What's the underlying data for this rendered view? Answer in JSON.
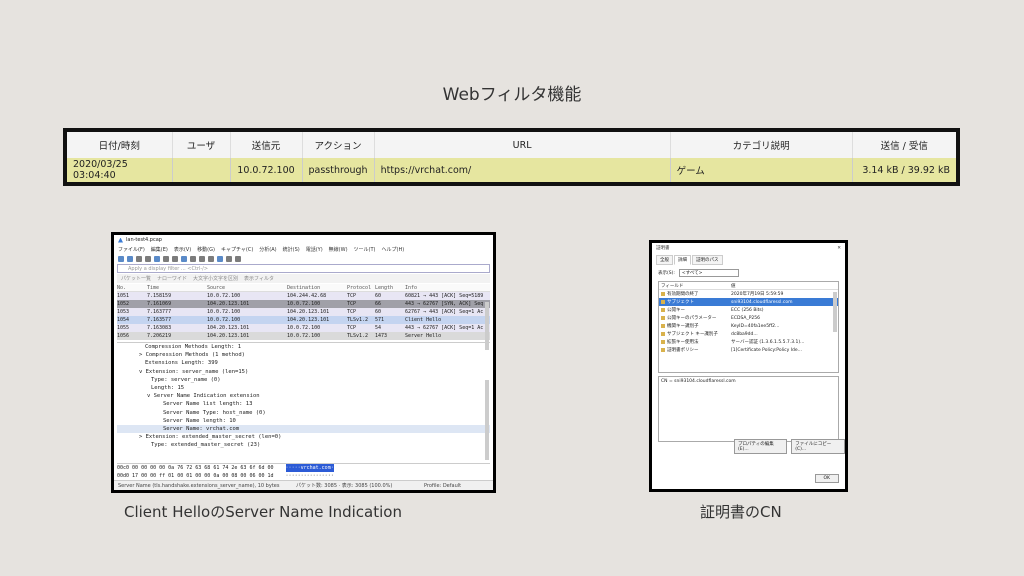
{
  "title": "Webフィルタ機能",
  "log_table": {
    "headers": [
      "日付/時刻",
      "ユーザ",
      "送信元",
      "アクション",
      "URL",
      "カテゴリ説明",
      "送信 / 受信"
    ],
    "row": [
      "2020/03/25 03:04:40",
      "",
      "10.0.72.100",
      "passthrough",
      "https://vrchat.com/",
      "ゲーム",
      "3.14 kB / 39.92 kB"
    ]
  },
  "wireshark": {
    "window_title": "lan-test4.pcap",
    "menu": [
      "ファイル(F)",
      "編集(E)",
      "表示(V)",
      "移動(G)",
      "キャプチャ(C)",
      "分析(A)",
      "統計(S)",
      "電話(Y)",
      "無線(W)",
      "ツール(T)",
      "ヘルプ(H)"
    ],
    "filter_placeholder": "Apply a display filter ... <Ctrl-/>",
    "filter2": [
      "パケット一覧",
      "ナローワイド",
      "大文字小文字を区別",
      "表示フィルタ"
    ],
    "columns": [
      "No.",
      "Time",
      "Source",
      "Destination",
      "Protocol",
      "Length",
      "Info"
    ],
    "packets": [
      [
        "1051",
        "7.158159",
        "10.0.72.100",
        "104.244.42.68",
        "TCP",
        "60",
        "60821 → 443 [ACK] Seq=5189"
      ],
      [
        "1052",
        "7.161069",
        "104.20.123.101",
        "10.0.72.100",
        "TCP",
        "66",
        "443 → 62767 [SYN, ACK] Seq"
      ],
      [
        "1053",
        "7.163777",
        "10.0.72.100",
        "104.20.123.101",
        "TCP",
        "60",
        "62767 → 443 [ACK] Seq=1 Ac"
      ],
      [
        "1054",
        "7.163577",
        "10.0.72.100",
        "104.20.123.101",
        "TLSv1.2",
        "571",
        "Client Hello"
      ],
      [
        "1055",
        "7.163083",
        "104.20.123.101",
        "10.0.72.100",
        "TCP",
        "54",
        "443 → 62767 [ACK] Seq=1 Ac"
      ],
      [
        "1056",
        "7.206219",
        "104.20.123.101",
        "10.0.72.100",
        "TLSv1.2",
        "1473",
        "Server Hello"
      ]
    ],
    "detail_lines": [
      "Compression Methods Length: 1",
      "> Compression Methods (1 method)",
      "Extensions Length: 399",
      "v Extension: server_name (len=15)",
      "Type: server_name (0)",
      "Length: 15",
      "v Server Name Indication extension",
      "Server Name list length: 13",
      "Server Name Type: host_name (0)",
      "Server Name length: 10",
      "Server Name: vrchat.com",
      "> Extension: extended_master_secret (len=0)",
      "Type: extended_master_secret (23)"
    ],
    "hex_lines": [
      "00c0  00 00 00 00 0a 76 72 63  68 61 74 2e 63 6f 6d 00",
      "00d0  17 00 00 ff 01 00 01 00  00 0a 00 08 00 06 00 1d"
    ],
    "hex_ascii": [
      "·····vrchat.com·",
      "················"
    ],
    "status": [
      "Server Name (tls.handshake.extensions_server_name), 10 bytes",
      "パケット数: 3085 · 表示: 3085 (100.0%)",
      "Profile: Default"
    ]
  },
  "cert": {
    "window_title": "証明書",
    "tabs": [
      "全般",
      "詳細",
      "証明のパス"
    ],
    "show_label": "表示(S):",
    "show_value": "<すべて>",
    "col_field": "フィールド",
    "col_value": "値",
    "rows": [
      [
        "有効期間の終了",
        "2020年7月19日 5:59:59"
      ],
      [
        "サブジェクト",
        "sni93104.cloudflaressl.com"
      ],
      [
        "公開キー",
        "ECC (256 Bits)"
      ],
      [
        "公開キーのパラメーター",
        "ECDSA_P256"
      ],
      [
        "機関キー識別子",
        "KeyID=40fa1ee5ff2..."
      ],
      [
        "サブジェクト キー識別子",
        "dc8ba9dd..."
      ],
      [
        "拡張キー使用法",
        "サーバー認証 (1.3.6.1.5.5.7.3.1)..."
      ],
      [
        "証明書ポリシー",
        "[1]Certificate Policy:Policy Ide..."
      ]
    ],
    "value_text": "CN = sni93104.cloudflaressl.com",
    "btn_edit": "プロパティの編集(E)...",
    "btn_copy": "ファイルにコピー(C)...",
    "btn_ok": "OK"
  },
  "captions": {
    "left": "Client HelloのServer Name Indication",
    "right": "証明書のCN"
  }
}
